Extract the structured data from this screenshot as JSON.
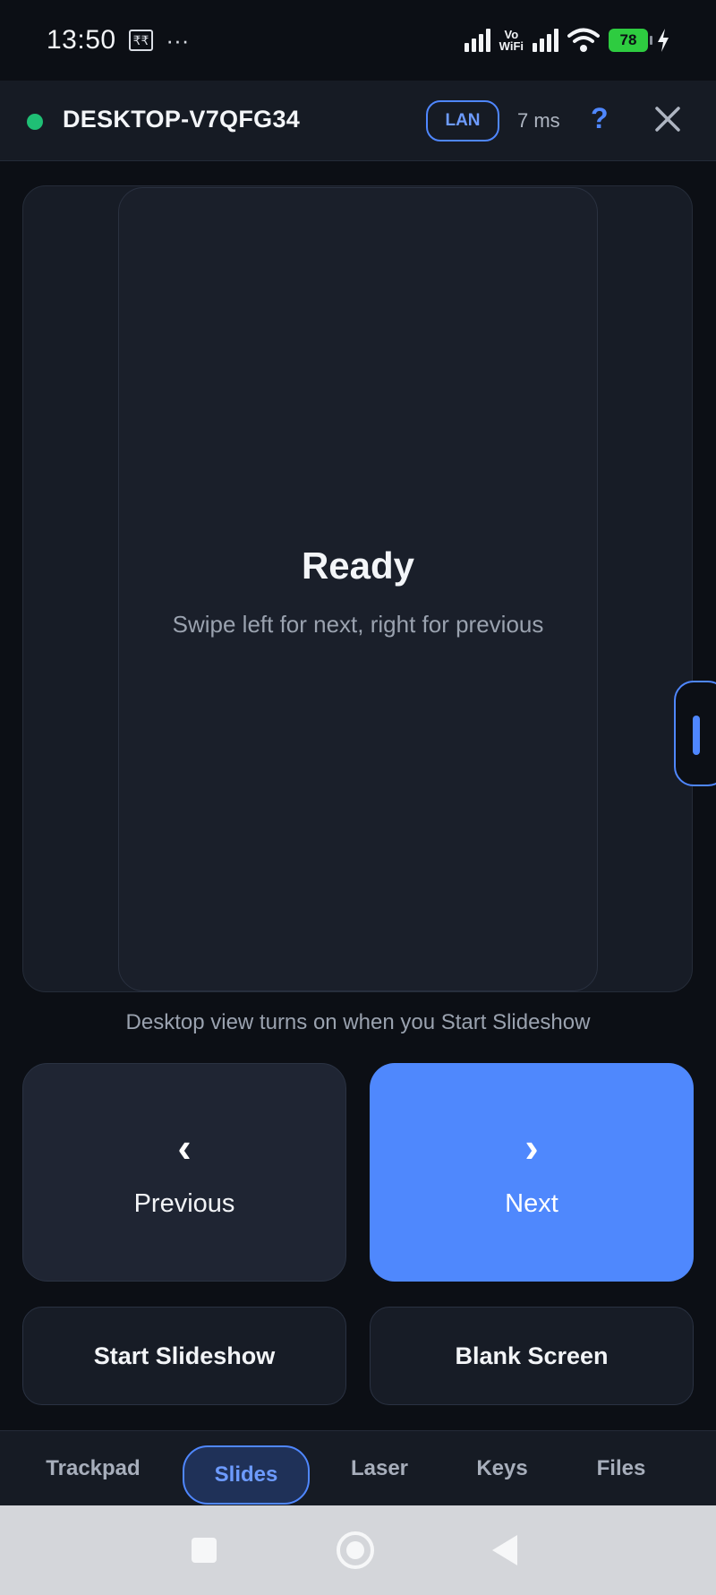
{
  "status_bar": {
    "time": "13:50",
    "rupee_badge": "₹₹",
    "dots": "···",
    "vowifi_top": "Vo",
    "vowifi_bottom": "WiFi",
    "battery": "78"
  },
  "header": {
    "device_name": "DESKTOP-V7QFG34",
    "connection": "LAN",
    "latency": "7 ms",
    "help": "?",
    "status_color": "#1fbf75"
  },
  "preview": {
    "title": "Ready",
    "subtitle": "Swipe left for next, right for previous"
  },
  "hint": "Desktop view turns on when you Start Slideshow",
  "controls": {
    "previous": {
      "icon": "‹",
      "label": "Previous"
    },
    "next": {
      "icon": "›",
      "label": "Next"
    },
    "start_slideshow": "Start Slideshow",
    "blank_screen": "Blank Screen"
  },
  "tabs": [
    {
      "label": "Trackpad",
      "active": false
    },
    {
      "label": "Slides",
      "active": true
    },
    {
      "label": "Laser",
      "active": false
    },
    {
      "label": "Keys",
      "active": false
    },
    {
      "label": "Files",
      "active": false
    }
  ],
  "colors": {
    "accent": "#4f88fd",
    "background": "#0c0f15",
    "surface": "#171c26"
  }
}
